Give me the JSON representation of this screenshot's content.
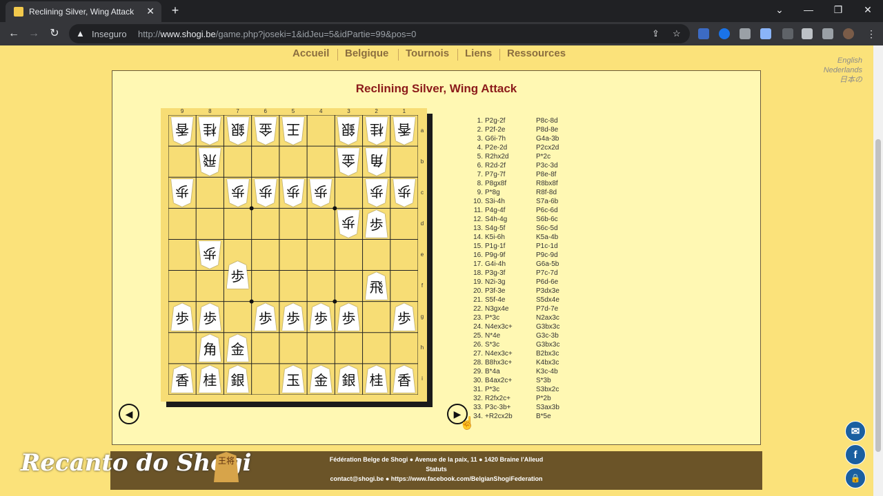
{
  "browser": {
    "tab_title": "Reclining Silver, Wing Attack",
    "tab_close": "✕",
    "new_tab": "+",
    "security_label": "Inseguro",
    "url_prefix": "http://",
    "url_domain": "www.shogi.be",
    "url_path": "/game.php?joseki=1&idJeu=5&idPartie=99&pos=0"
  },
  "site_nav": {
    "items": [
      {
        "label": "Accueil"
      },
      {
        "label": "Belgique"
      },
      {
        "label": "Tournois"
      },
      {
        "label": "Liens"
      },
      {
        "label": "Ressources"
      }
    ]
  },
  "languages": [
    "English",
    "Nederlands",
    "日本の"
  ],
  "game": {
    "title": "Reclining Silver, Wing Attack",
    "col_labels": [
      "9",
      "8",
      "7",
      "6",
      "5",
      "4",
      "3",
      "2",
      "1"
    ],
    "row_labels": [
      "a",
      "b",
      "c",
      "d",
      "e",
      "f",
      "g",
      "h",
      "i"
    ],
    "pieces": [
      {
        "col": 0,
        "row": 0,
        "char": "香",
        "side": "gote"
      },
      {
        "col": 1,
        "row": 0,
        "char": "桂",
        "side": "gote"
      },
      {
        "col": 2,
        "row": 0,
        "char": "銀",
        "side": "gote"
      },
      {
        "col": 3,
        "row": 0,
        "char": "金",
        "side": "gote"
      },
      {
        "col": 4,
        "row": 0,
        "char": "王",
        "side": "gote"
      },
      {
        "col": 6,
        "row": 0,
        "char": "銀",
        "side": "gote"
      },
      {
        "col": 7,
        "row": 0,
        "char": "桂",
        "side": "gote"
      },
      {
        "col": 8,
        "row": 0,
        "char": "香",
        "side": "gote"
      },
      {
        "col": 1,
        "row": 1,
        "char": "飛",
        "side": "gote"
      },
      {
        "col": 6,
        "row": 1,
        "char": "金",
        "side": "gote"
      },
      {
        "col": 7,
        "row": 1,
        "char": "角",
        "side": "gote"
      },
      {
        "col": 0,
        "row": 2,
        "char": "歩",
        "side": "gote"
      },
      {
        "col": 2,
        "row": 2,
        "char": "歩",
        "side": "gote"
      },
      {
        "col": 3,
        "row": 2,
        "char": "歩",
        "side": "gote"
      },
      {
        "col": 4,
        "row": 2,
        "char": "歩",
        "side": "gote"
      },
      {
        "col": 5,
        "row": 2,
        "char": "歩",
        "side": "gote"
      },
      {
        "col": 7,
        "row": 2,
        "char": "歩",
        "side": "gote"
      },
      {
        "col": 8,
        "row": 2,
        "char": "歩",
        "side": "gote"
      },
      {
        "col": 6,
        "row": 3,
        "char": "歩",
        "side": "gote"
      },
      {
        "col": 7,
        "row": 3,
        "char": "歩",
        "side": "sente"
      },
      {
        "col": 1,
        "row": 4,
        "char": "歩",
        "side": "gote"
      },
      {
        "col": 7,
        "row": 5,
        "char": "飛",
        "side": "sente"
      },
      {
        "col": 2,
        "row": 5,
        "char": "歩",
        "side": "sente"
      },
      {
        "col": 0,
        "row": 6,
        "char": "歩",
        "side": "sente"
      },
      {
        "col": 1,
        "row": 6,
        "char": "歩",
        "side": "sente"
      },
      {
        "col": 3,
        "row": 6,
        "char": "歩",
        "side": "sente"
      },
      {
        "col": 4,
        "row": 6,
        "char": "歩",
        "side": "sente"
      },
      {
        "col": 5,
        "row": 6,
        "char": "歩",
        "side": "sente"
      },
      {
        "col": 6,
        "row": 6,
        "char": "歩",
        "side": "sente"
      },
      {
        "col": 8,
        "row": 6,
        "char": "歩",
        "side": "sente"
      },
      {
        "col": 1,
        "row": 7,
        "char": "角",
        "side": "sente"
      },
      {
        "col": 2,
        "row": 7,
        "char": "金",
        "side": "sente"
      },
      {
        "col": 0,
        "row": 8,
        "char": "香",
        "side": "sente"
      },
      {
        "col": 1,
        "row": 8,
        "char": "桂",
        "side": "sente"
      },
      {
        "col": 2,
        "row": 8,
        "char": "銀",
        "side": "sente"
      },
      {
        "col": 4,
        "row": 8,
        "char": "玉",
        "side": "sente"
      },
      {
        "col": 5,
        "row": 8,
        "char": "金",
        "side": "sente"
      },
      {
        "col": 6,
        "row": 8,
        "char": "銀",
        "side": "sente"
      },
      {
        "col": 7,
        "row": 8,
        "char": "桂",
        "side": "sente"
      },
      {
        "col": 8,
        "row": 8,
        "char": "香",
        "side": "sente"
      }
    ],
    "moves": [
      [
        "1.",
        "P2g-2f",
        "P8c-8d"
      ],
      [
        "2.",
        "P2f-2e",
        "P8d-8e"
      ],
      [
        "3.",
        "G6i-7h",
        "G4a-3b"
      ],
      [
        "4.",
        "P2e-2d",
        "P2cx2d"
      ],
      [
        "5.",
        "R2hx2d",
        "P*2c"
      ],
      [
        "6.",
        "R2d-2f",
        "P3c-3d"
      ],
      [
        "7.",
        "P7g-7f",
        "P8e-8f"
      ],
      [
        "8.",
        "P8gx8f",
        "R8bx8f"
      ],
      [
        "9.",
        "P*8g",
        "R8f-8d"
      ],
      [
        "10.",
        "S3i-4h",
        "S7a-6b"
      ],
      [
        "11.",
        "P4g-4f",
        "P6c-6d"
      ],
      [
        "12.",
        "S4h-4g",
        "S6b-6c"
      ],
      [
        "13.",
        "S4g-5f",
        "S6c-5d"
      ],
      [
        "14.",
        "K5i-6h",
        "K5a-4b"
      ],
      [
        "15.",
        "P1g-1f",
        "P1c-1d"
      ],
      [
        "16.",
        "P9g-9f",
        "P9c-9d"
      ],
      [
        "17.",
        "G4i-4h",
        "G6a-5b"
      ],
      [
        "18.",
        "P3g-3f",
        "P7c-7d"
      ],
      [
        "19.",
        "N2i-3g",
        "P6d-6e"
      ],
      [
        "20.",
        "P3f-3e",
        "P3dx3e"
      ],
      [
        "21.",
        "S5f-4e",
        "S5dx4e"
      ],
      [
        "22.",
        "N3gx4e",
        "P7d-7e"
      ],
      [
        "23.",
        "P*3c",
        "N2ax3c"
      ],
      [
        "24.",
        "N4ex3c+",
        "G3bx3c"
      ],
      [
        "25.",
        "N*4e",
        "G3c-3b"
      ],
      [
        "26.",
        "S*3c",
        "G3bx3c"
      ],
      [
        "27.",
        "N4ex3c+",
        "B2bx3c"
      ],
      [
        "28.",
        "B8hx3c+",
        "K4bx3c"
      ],
      [
        "29.",
        "B*4a",
        "K3c-4b"
      ],
      [
        "30.",
        "B4ax2c+",
        "S*3b"
      ],
      [
        "31.",
        "P*3c",
        "S3bx2c"
      ],
      [
        "32.",
        "R2fx2c+",
        "P*2b"
      ],
      [
        "33.",
        "P3c-3b+",
        "S3ax3b"
      ],
      [
        "34.",
        "+R2cx2b",
        "B*5e"
      ]
    ],
    "prev_icon": "◀",
    "next_icon": "▶"
  },
  "footer": {
    "line1": "Fédération Belge de Shogi ● Avenue de la paix, 11 ● 1420 Braine l'Alleud",
    "line2": "Statuts",
    "line3": "contact@shogi.be ● https://www.facebook.com/BelgianShogiFederation"
  },
  "watermark": {
    "text": "Recanto do Shogi",
    "badge": "王将"
  },
  "float_buttons": [
    {
      "name": "email-float-button",
      "icon": "✉"
    },
    {
      "name": "facebook-float-button",
      "icon": "f"
    },
    {
      "name": "lock-float-button",
      "icon": "🔒"
    }
  ]
}
